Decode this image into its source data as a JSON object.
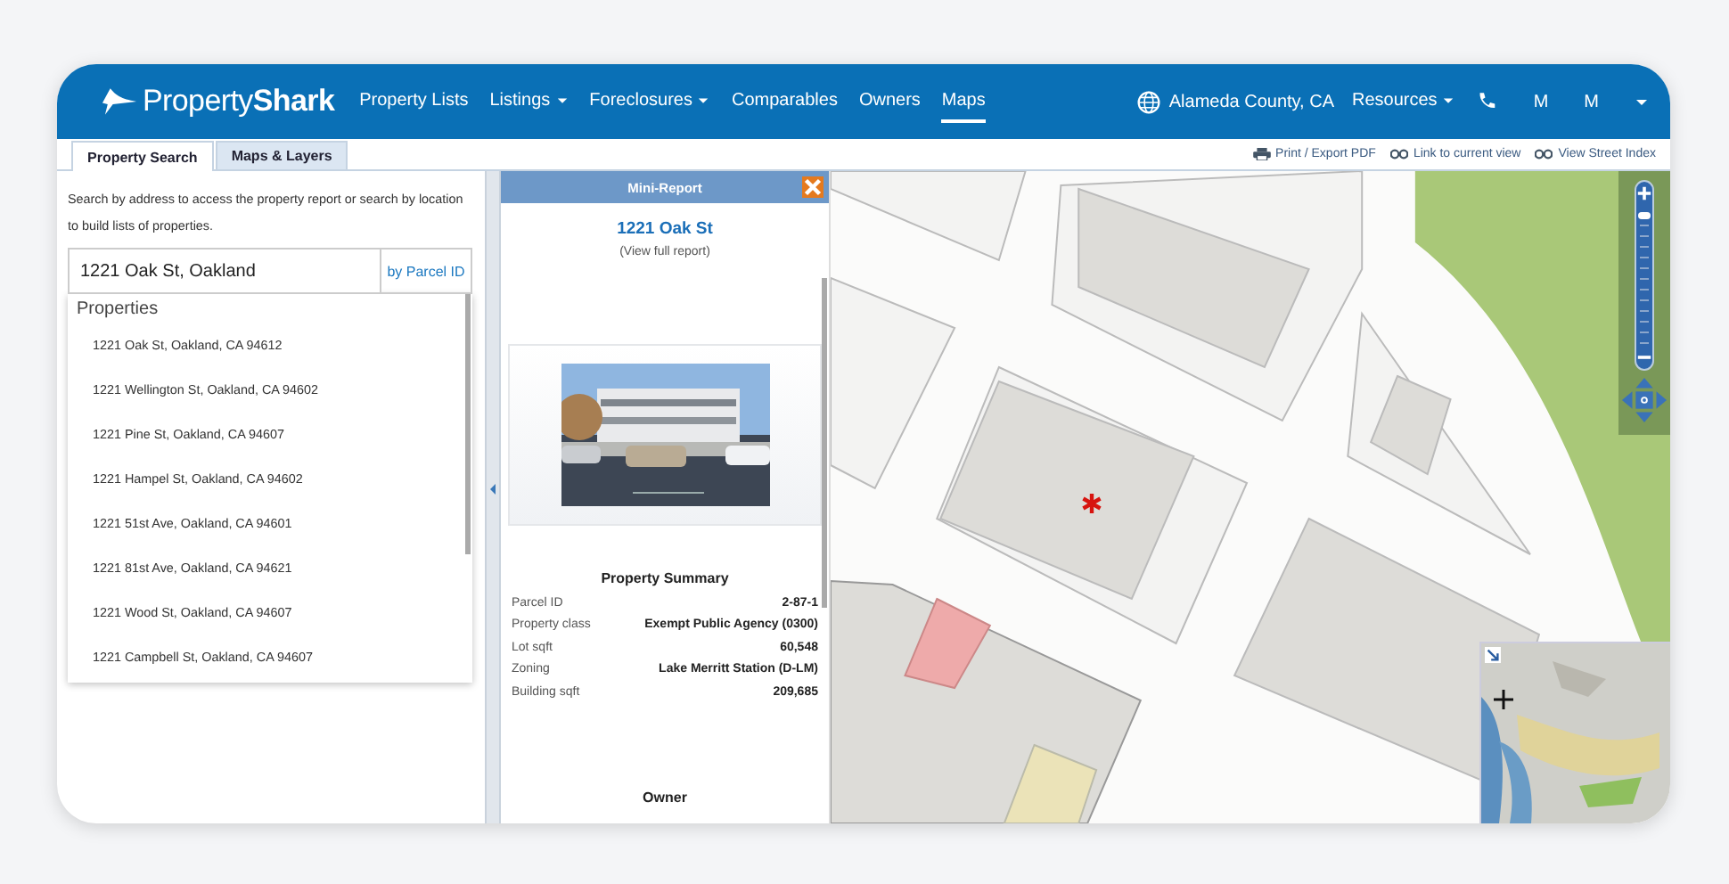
{
  "header": {
    "logo": "Property**Shark**",
    "nav": [
      {
        "label": "Property Lists",
        "dropdown": false,
        "selected": false
      },
      {
        "label": "Listings",
        "dropdown": true,
        "selected": false
      },
      {
        "label": "Foreclosures",
        "dropdown": true,
        "selected": false
      },
      {
        "label": "Comparables",
        "dropdown": false,
        "selected": false
      },
      {
        "label": "Owners",
        "dropdown": false,
        "selected": false
      },
      {
        "label": "Maps",
        "dropdown": false,
        "selected": true
      }
    ],
    "county": "Alameda County, CA",
    "resources": "Resources",
    "users": [
      "M",
      "M"
    ]
  },
  "tabs": [
    {
      "label": "Property Search",
      "selected": true
    },
    {
      "label": "Maps & Layers",
      "selected": false
    }
  ],
  "toolbar": [
    {
      "kind": "print",
      "label": "Print / Export PDF"
    },
    {
      "kind": "link",
      "label": "Link to current view"
    },
    {
      "kind": "link",
      "label": "View Street Index"
    }
  ],
  "search": {
    "description": "Search by address to access the property report or search by location to build lists of properties.",
    "value": "1221 Oak St, Oakland",
    "parcel_link": "by Parcel ID",
    "results_heading": "Properties",
    "results": [
      "1221 Oak St, Oakland, CA 94612",
      "1221 Wellington St, Oakland, CA 94602",
      "1221 Pine St, Oakland, CA 94607",
      "1221 Hampel St, Oakland, CA 94602",
      "1221 51st Ave, Oakland, CA 94601",
      "1221 81st Ave, Oakland, CA 94621",
      "1221 Wood St, Oakland, CA 94607",
      "1221 Campbell St, Oakland, CA 94607"
    ]
  },
  "mini_report": {
    "title": "Mini-Report",
    "address": "1221 Oak St",
    "full_report_link": "(View full report)",
    "summary_title": "Property Summary",
    "summary": [
      {
        "label": "Parcel ID",
        "value": "2-87-1"
      },
      {
        "label": "Property class",
        "value": "Exempt Public Agency (0300)"
      },
      {
        "label": "Lot sqft",
        "value": "60,548"
      },
      {
        "label": "Zoning",
        "value": "Lake Merritt Station (D-LM)"
      },
      {
        "label": "Building sqft",
        "value": "209,685"
      }
    ],
    "owner_heading": "Owner"
  },
  "map": {
    "zoom": {
      "level": 0.95
    }
  }
}
